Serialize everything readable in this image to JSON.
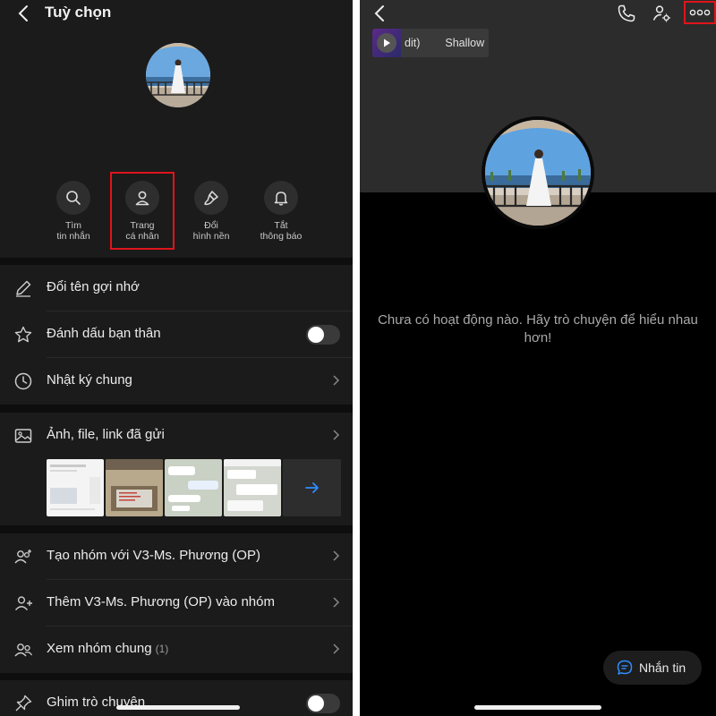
{
  "left": {
    "title": "Tuỳ chọn",
    "quick_actions": [
      {
        "line1": "Tìm",
        "line2": "tin nhắn",
        "icon": "search-icon"
      },
      {
        "line1": "Trang",
        "line2": "cá nhân",
        "icon": "user-icon"
      },
      {
        "line1": "Đổi",
        "line2": "hình nền",
        "icon": "brush-icon"
      },
      {
        "line1": "Tắt",
        "line2": "thông báo",
        "icon": "bell-icon"
      }
    ],
    "rows": {
      "rename": "Đổi tên gợi nhớ",
      "best_friend": "Đánh dấu bạn thân",
      "diary": "Nhật ký chung",
      "media": "Ảnh, file, link đã gửi",
      "create_group": "Tạo nhóm với V3-Ms. Phương (OP)",
      "add_to_group": "Thêm V3-Ms. Phương (OP) vào nhóm",
      "common_groups": "Xem nhóm chung",
      "common_groups_count": "(1)",
      "pin_chat": "Ghim trò chuyện"
    },
    "toggles": {
      "best_friend": false,
      "pin_chat": false
    }
  },
  "right": {
    "music_title_left": "dit)",
    "music_title_right": "Shallow",
    "empty_message": "Chưa có hoạt động nào. Hãy trò chuyện để hiểu nhau hơn!",
    "message_button": "Nhắn tin"
  },
  "colors": {
    "highlight": "#e0141b",
    "accent": "#2f8cff",
    "background": "#0e0e0e",
    "panel": "#1b1b1b"
  }
}
